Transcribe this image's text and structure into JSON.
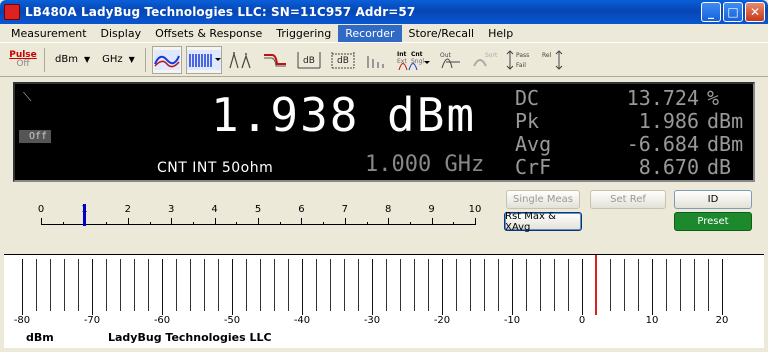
{
  "window": {
    "title": "LB480A LadyBug Technologies LLC: SN=11C957  Addr=57"
  },
  "menu": [
    "Measurement",
    "Display",
    "Offsets & Response",
    "Triggering",
    "Recorder",
    "Store/Recall",
    "Help"
  ],
  "menu_active_index": 4,
  "toolbar": {
    "pulse_label": "Pulse",
    "pulse_state": "Off",
    "unit_select": "dBm",
    "freq_unit_select": "GHz",
    "icons": [
      "waveform-icon",
      "pulse-train-icon",
      "peak-markers-icon",
      "filter-icon",
      "delta-db-icon",
      "delta-db-avg-icon",
      "ramp-icon",
      "int-ext-trigger-icon",
      "out-icon",
      "sort-icon",
      "pass-fail-icon",
      "rel-icon"
    ],
    "trigger_labels": {
      "int": "Int",
      "ext": "Ext",
      "cont": "Cnt",
      "sngl": "Sngl"
    },
    "small_labels": {
      "out": "Out",
      "sort": "Sort",
      "pass": "Pass",
      "fail": "Fail",
      "rel": "Rel"
    }
  },
  "meter": {
    "main_value": "1.938",
    "main_unit": "dBm",
    "off_label": "Off",
    "status_line": "CNT  INT  50ohm",
    "frequency": "1.000 GHz",
    "stats": [
      {
        "label": "DC",
        "value": "13.724",
        "unit": "%"
      },
      {
        "label": "Pk",
        "value": "1.986",
        "unit": "dBm"
      },
      {
        "label": "Avg",
        "value": "-6.684",
        "unit": "dBm"
      },
      {
        "label": "CrF",
        "value": "8.670",
        "unit": "dB"
      }
    ]
  },
  "bar_ruler": {
    "labels": [
      "0",
      "1",
      "2",
      "3",
      "4",
      "5",
      "6",
      "7",
      "8",
      "9",
      "10"
    ],
    "marker_value": 1
  },
  "buttons": {
    "single_meas": "Single Meas",
    "set_ref": "Set Ref",
    "id": "ID",
    "rst_max": "Rst Max & XAvg",
    "preset": "Preset"
  },
  "analog": {
    "labels": [
      "-80",
      "-70",
      "-60",
      "-50",
      "-40",
      "-30",
      "-20",
      "-10",
      "0",
      "10",
      "20"
    ],
    "min": -80,
    "max": 20,
    "needle_value": 2,
    "unit": "dBm",
    "brand": "LadyBug Technologies LLC"
  },
  "colors": {
    "title_bar": "#0646b5",
    "needle": "#e02020",
    "marker": "#0000cc",
    "preset": "#1c8a2c"
  }
}
